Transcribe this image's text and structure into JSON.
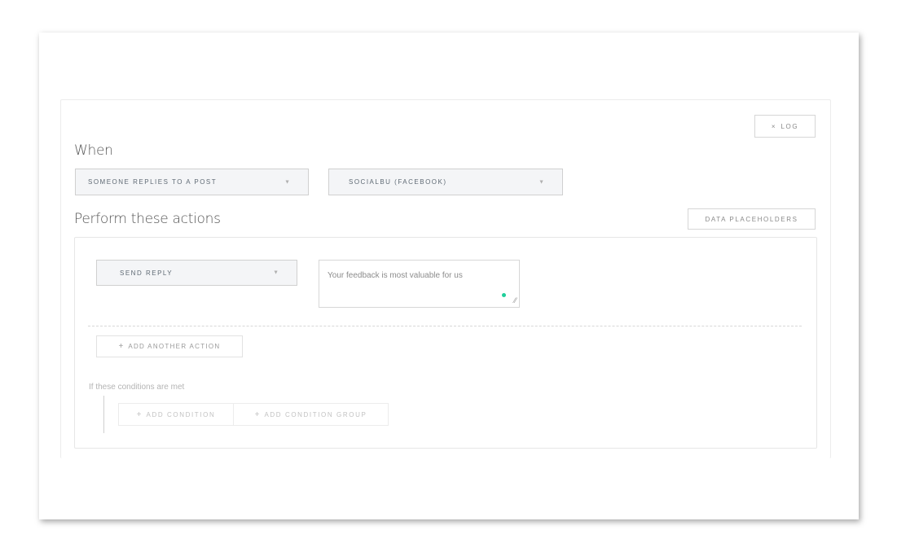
{
  "header": {
    "log_label": "LOG",
    "log_icon": "x-icon"
  },
  "when": {
    "heading": "When",
    "trigger": {
      "value": "SOMEONE REPLIES TO A POST"
    },
    "account": {
      "value": "SOCIALBU (FACEBOOK)"
    }
  },
  "actions": {
    "heading": "Perform these actions",
    "placeholders_label": "DATA PLACEHOLDERS",
    "items": [
      {
        "type": "SEND REPLY",
        "reply_text": "Your feedback is most valuable for us"
      }
    ],
    "add_action_label": "ADD ANOTHER ACTION"
  },
  "conditions": {
    "label": "If these conditions are met",
    "add_condition_label": "ADD CONDITION",
    "add_group_label": "ADD CONDITION GROUP"
  },
  "colors": {
    "status_dot": "#1fcf9a",
    "select_bg": "#f4f5f7"
  }
}
